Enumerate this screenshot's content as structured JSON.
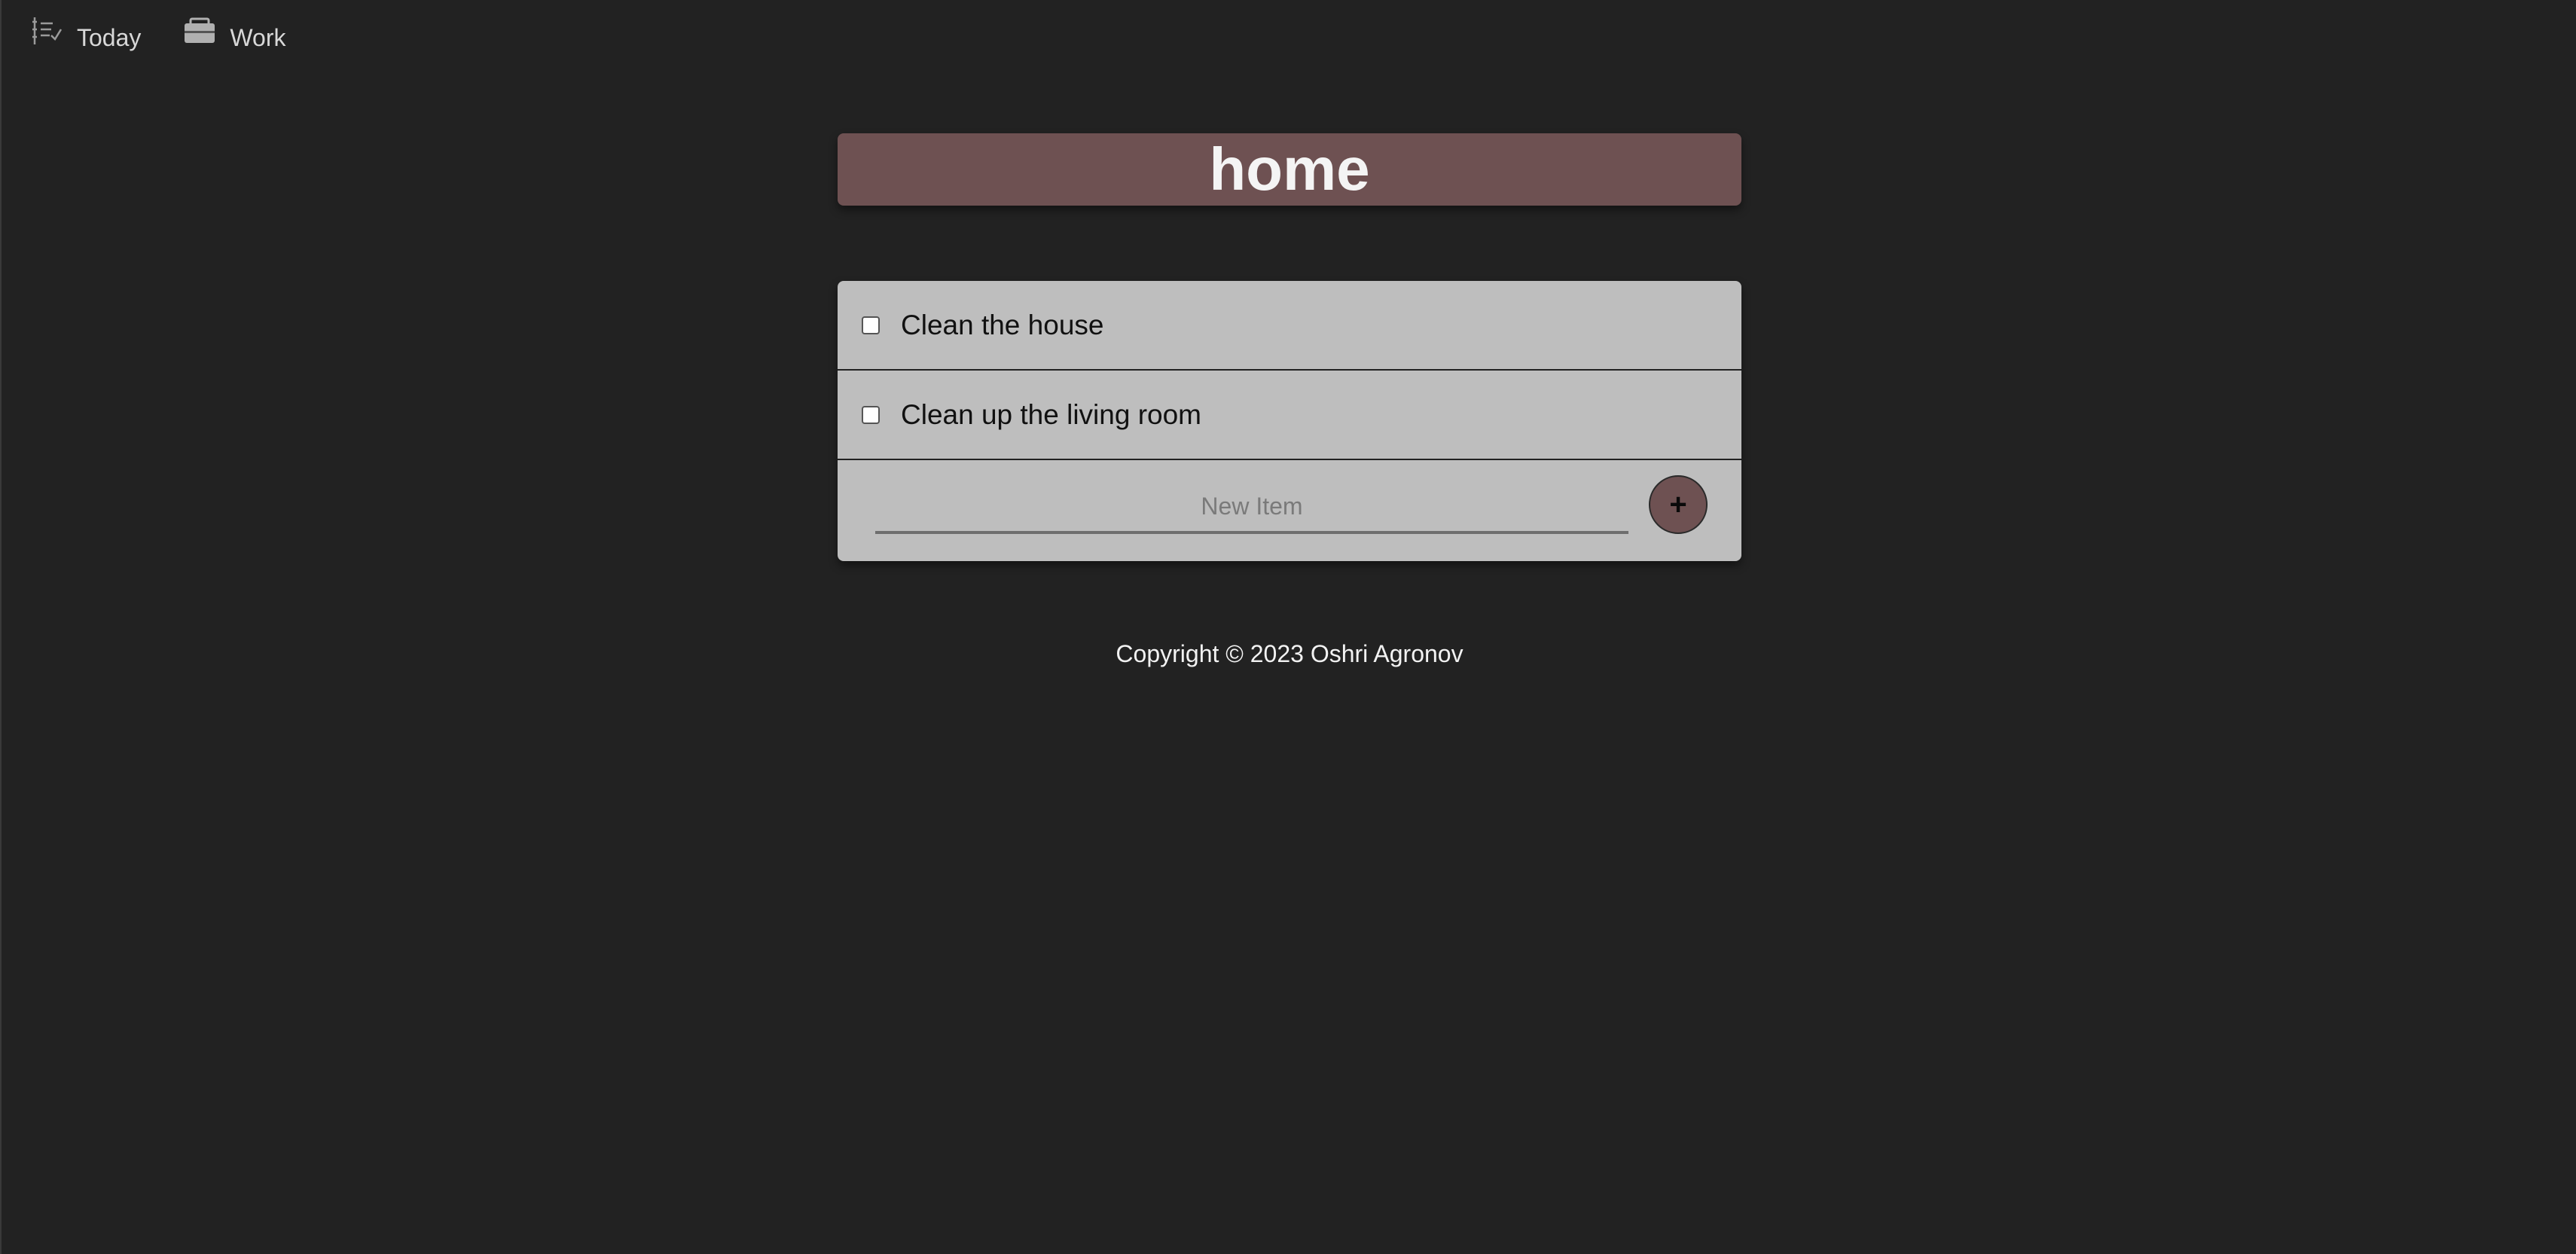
{
  "nav": {
    "items": [
      {
        "label": "Today",
        "icon": "list-check-icon"
      },
      {
        "label": "Work",
        "icon": "briefcase-icon"
      }
    ]
  },
  "list": {
    "title": "home",
    "items": [
      {
        "label": "Clean the house",
        "checked": false
      },
      {
        "label": "Clean up the living room",
        "checked": false
      }
    ],
    "new_item_placeholder": "New Item",
    "add_button_label": "+"
  },
  "footer": {
    "text": "Copyright © 2023 Oshri Agronov"
  },
  "colors": {
    "background": "#222222",
    "accent": "#6e5152",
    "list_background": "#bebebe"
  }
}
